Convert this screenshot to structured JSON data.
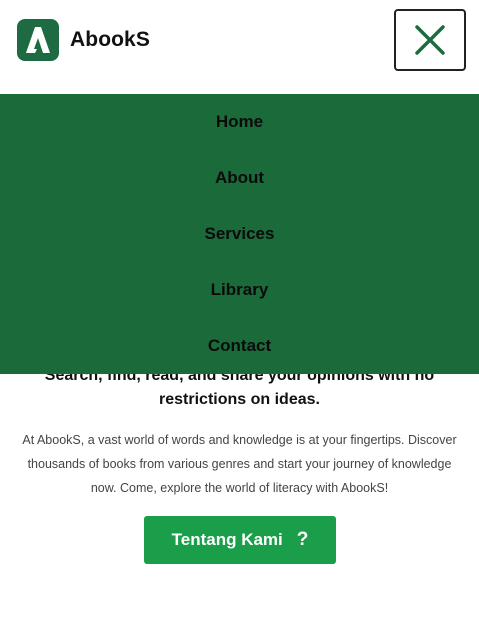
{
  "brand": {
    "name": "AbookS",
    "logo_color": "#1e6a42"
  },
  "header": {
    "close_icon": "close-icon"
  },
  "menu": {
    "background": "#1a6a3a",
    "items": [
      {
        "label": "Home"
      },
      {
        "label": "About"
      },
      {
        "label": "Services"
      },
      {
        "label": "Library"
      },
      {
        "label": "Contact"
      }
    ]
  },
  "hero": {
    "subtitle": "Search, find, read, and share your opinions with no restrictions on ideas.",
    "description": "At AbookS, a vast world of words and knowledge is at your fingertips. Discover thousands of books from various genres and start your journey of knowledge now. Come, explore the world of literacy with AbookS!",
    "cta_label": "Tentang Kami",
    "cta_icon": "question-icon",
    "cta_icon_glyph": "?",
    "cta_color": "#1a9e4a"
  }
}
